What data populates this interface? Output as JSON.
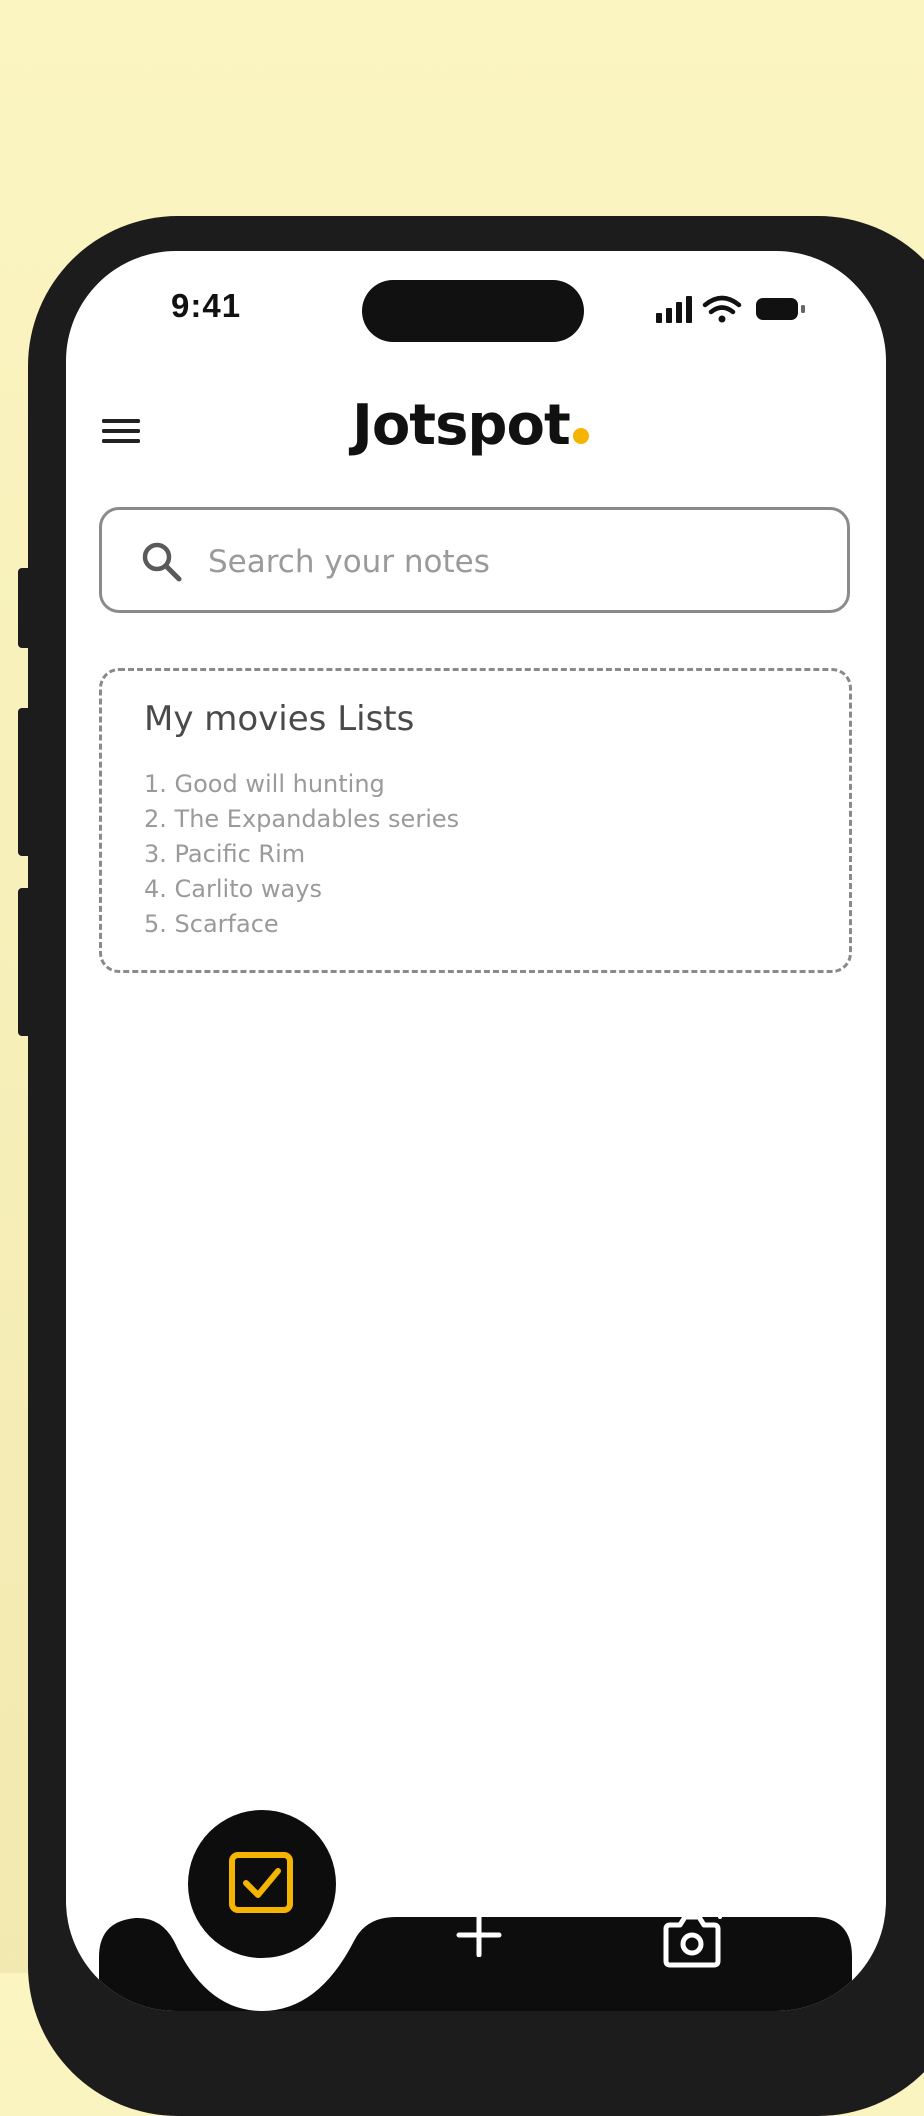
{
  "status_bar": {
    "time": "9:41"
  },
  "header": {
    "app_name": "Jotspot",
    "accent_color": "#f4b400"
  },
  "search": {
    "placeholder": "Search your notes"
  },
  "notes": [
    {
      "title": "My movies Lists",
      "items": [
        "1. Good will hunting",
        "2. The Expandables series",
        "3. Pacific Rim",
        "4. Carlito ways",
        "5. Scarface"
      ]
    }
  ],
  "bottom_bar": {
    "fab_icon": "checkbox-icon",
    "actions": [
      {
        "icon": "plus-icon"
      },
      {
        "icon": "camera-plus-icon"
      }
    ]
  }
}
